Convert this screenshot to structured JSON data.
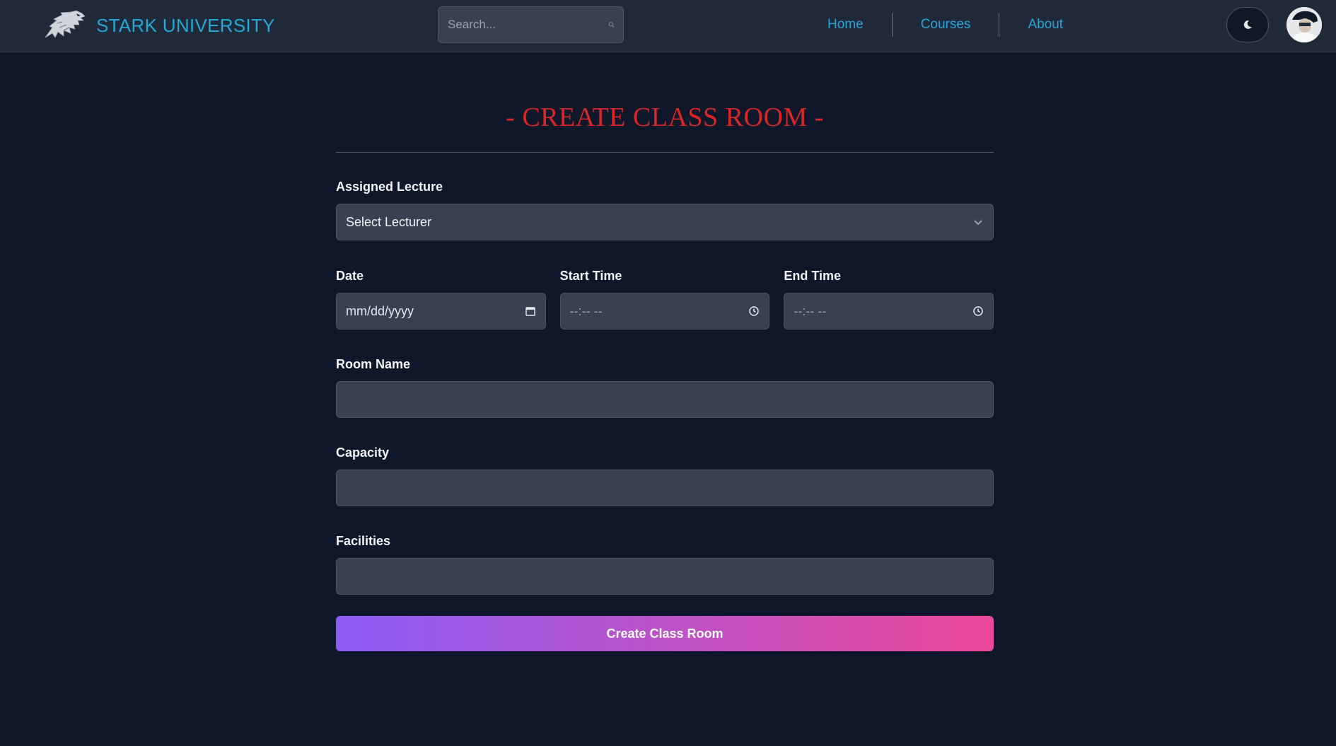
{
  "navbar": {
    "brand_name": "STARK UNIVERSITY",
    "search_placeholder": "Search...",
    "links": {
      "home": "Home",
      "courses": "Courses",
      "about": "About"
    }
  },
  "form": {
    "title": "- CREATE CLASS ROOM -",
    "assigned_lecture": {
      "label": "Assigned Lecture",
      "selected": "Select Lecturer"
    },
    "date": {
      "label": "Date",
      "placeholder": "mm/dd/yyyy"
    },
    "start_time": {
      "label": "Start Time",
      "placeholder": "--:-- --"
    },
    "end_time": {
      "label": "End Time",
      "placeholder": "--:-- --"
    },
    "room_name": {
      "label": "Room Name",
      "value": ""
    },
    "capacity": {
      "label": "Capacity",
      "value": ""
    },
    "facilities": {
      "label": "Facilities",
      "value": ""
    },
    "submit_label": "Create Class Room"
  },
  "colors": {
    "background": "#0f172a",
    "navbar": "#1f2937",
    "brand": "#22a9d6",
    "title": "#dc2626",
    "input_bg": "#374151",
    "button_gradient_start": "#8b5cf6",
    "button_gradient_end": "#ec4899"
  },
  "icons": {
    "logo": "direwolf-logo-icon",
    "search": "search-icon",
    "theme": "moon-icon",
    "select": "chevron-down-icon",
    "date": "calendar-icon",
    "time": "clock-icon"
  }
}
